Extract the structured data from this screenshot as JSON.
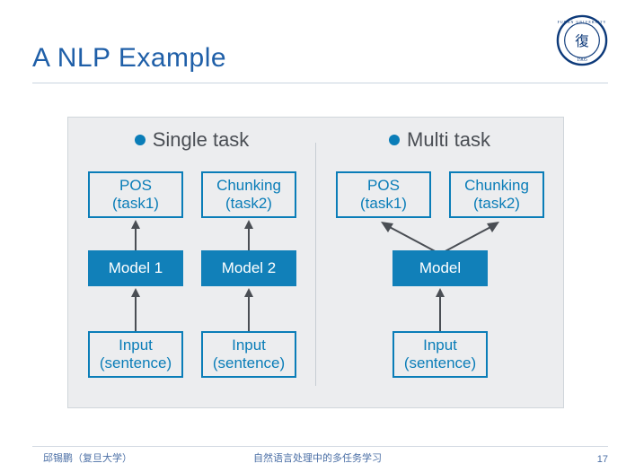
{
  "title": "A NLP Example",
  "logo_year": "1905",
  "panels": {
    "single": {
      "heading": "Single task",
      "task1_l1": "POS",
      "task1_l2": "(task1)",
      "task2_l1": "Chunking",
      "task2_l2": "(task2)",
      "model1": "Model 1",
      "model2": "Model 2",
      "input_l1": "Input",
      "input_l2": "(sentence)"
    },
    "multi": {
      "heading": "Multi task",
      "task1_l1": "POS",
      "task1_l2": "(task1)",
      "task2_l1": "Chunking",
      "task2_l2": "(task2)",
      "model": "Model",
      "input_l1": "Input",
      "input_l2": "(sentence)"
    }
  },
  "footer": {
    "author": "邱锡鹏（复旦大学）",
    "topic": "自然语言处理中的多任务学习",
    "page": "17"
  },
  "chart_data": {
    "type": "diagram",
    "description": "Comparison of single-task vs multi-task NLP architectures",
    "left": {
      "label": "Single task",
      "flows": [
        [
          "Input (sentence)",
          "Model 1",
          "POS (task1)"
        ],
        [
          "Input (sentence)",
          "Model 2",
          "Chunking (task2)"
        ]
      ]
    },
    "right": {
      "label": "Multi task",
      "flows": [
        [
          "Input (sentence)",
          "Model",
          "POS (task1)"
        ],
        [
          "Input (sentence)",
          "Model",
          "Chunking (task2)"
        ]
      ]
    }
  }
}
